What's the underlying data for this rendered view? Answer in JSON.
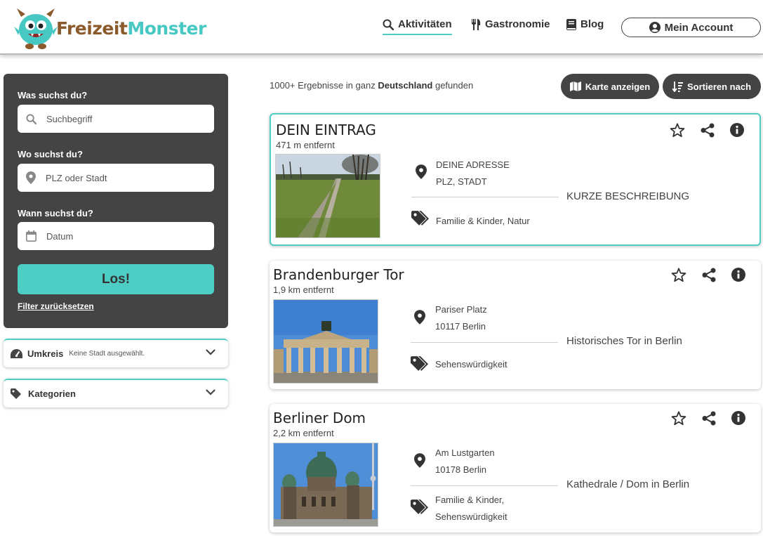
{
  "brand": {
    "part1": "Freizeit",
    "part2": "Monster"
  },
  "nav": {
    "activities": "Aktivitäten",
    "gastronomy": "Gastronomie",
    "blog": "Blog",
    "account": "Mein Account"
  },
  "search": {
    "what_label": "Was suchst du?",
    "what_placeholder": "Suchbegriff",
    "where_label": "Wo suchst du?",
    "where_placeholder": "PLZ oder Stadt",
    "when_label": "Wann suchst du?",
    "when_placeholder": "Datum",
    "submit": "Los!",
    "reset": "Filter zurücksetzen"
  },
  "filters": {
    "radius": {
      "title": "Umkreis",
      "subtitle": "Keine Stadt ausgewählt."
    },
    "categories": {
      "title": "Kategorien"
    }
  },
  "results": {
    "count_prefix": "1000+ Ergebnisse in ganz",
    "count_region": "Deutschland",
    "count_suffix": "gefunden",
    "map_button": "Karte anzeigen",
    "sort_button": "Sortieren nach"
  },
  "cards": [
    {
      "title": "DEIN EINTRAG",
      "distance": "471 m entfernt",
      "address1": "DEINE ADRESSE",
      "address2": "PLZ, STADT",
      "tags": "Familie & Kinder, Natur",
      "description": "KURZE BESCHREIBUNG"
    },
    {
      "title": "Brandenburger Tor",
      "distance": "1,9 km entfernt",
      "address1": "Pariser Platz",
      "address2": "10117 Berlin",
      "tags": "Sehenswürdigkeit",
      "description": "Historisches Tor in Berlin"
    },
    {
      "title": "Berliner Dom",
      "distance": "2,2 km entfernt",
      "address1": "Am Lustgarten",
      "address2": "10178 Berlin",
      "tags": "Familie & Kinder, Sehenswürdigkeit",
      "description": "Kathedrale / Dom in Berlin"
    }
  ],
  "colors": {
    "accent": "#4ecdc4",
    "panel": "#444444",
    "brand_brown": "#8b5a2b",
    "brand_teal": "#47c8c3"
  },
  "icons": [
    "search-icon",
    "map-pin-icon",
    "calendar-icon",
    "dashboard-icon",
    "tag-icon",
    "chevron-down-icon",
    "star-icon",
    "share-icon",
    "info-icon",
    "map-icon",
    "sort-icon",
    "user-circle-icon",
    "fork-knife-icon",
    "book-icon"
  ]
}
